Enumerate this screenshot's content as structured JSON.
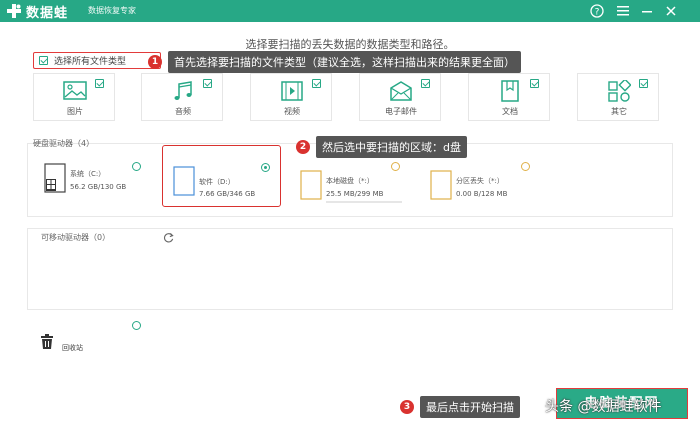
{
  "app": {
    "title": "数据蛙",
    "subtitle": "数据恢复专家",
    "accent_color": "#27a886"
  },
  "heading": "选择要扫描的丢失数据的数据类型和路径。",
  "select_all": {
    "label": "选择所有文件类型",
    "checked": true
  },
  "callouts": [
    {
      "num": "1",
      "text": "首先选择要扫描的文件类型（建议全选，这样扫描出来的结果更全面）"
    },
    {
      "num": "2",
      "text": "然后选中要扫描的区域：d盘"
    },
    {
      "num": "3",
      "text": "最后点击开始扫描"
    }
  ],
  "file_types": [
    {
      "label": "图片",
      "icon": "image-icon",
      "checked": true
    },
    {
      "label": "音频",
      "icon": "music-icon",
      "checked": true
    },
    {
      "label": "视频",
      "icon": "video-icon",
      "checked": true
    },
    {
      "label": "电子邮件",
      "icon": "email-icon",
      "checked": true
    },
    {
      "label": "文档",
      "icon": "document-icon",
      "checked": true
    },
    {
      "label": "其它",
      "icon": "other-icon",
      "checked": true
    }
  ],
  "disk_section": {
    "label": "硬盘驱动器（4）"
  },
  "drives": [
    {
      "name": "系统（C:）",
      "size": "56.2 GB/130 GB",
      "icon": "windows-drive-icon",
      "selected": false
    },
    {
      "name": "软件（D:）",
      "size": "7.66 GB/346 GB",
      "icon": "drive-icon",
      "selected": true
    },
    {
      "name": "本地磁盘（*:）",
      "size": "25.5 MB/299 MB",
      "icon": "drive-icon",
      "selected": false
    },
    {
      "name": "分区丢失（*:）",
      "size": "0.00  B/128 MB",
      "icon": "drive-icon",
      "selected": false
    }
  ],
  "removable_section": {
    "label": "可移动驱动器（0）"
  },
  "recycle": {
    "label": "回收站",
    "icon": "trash-icon"
  },
  "start_button": {
    "label": "电脑装配网"
  },
  "watermark": "头条 @数据蛙软件"
}
